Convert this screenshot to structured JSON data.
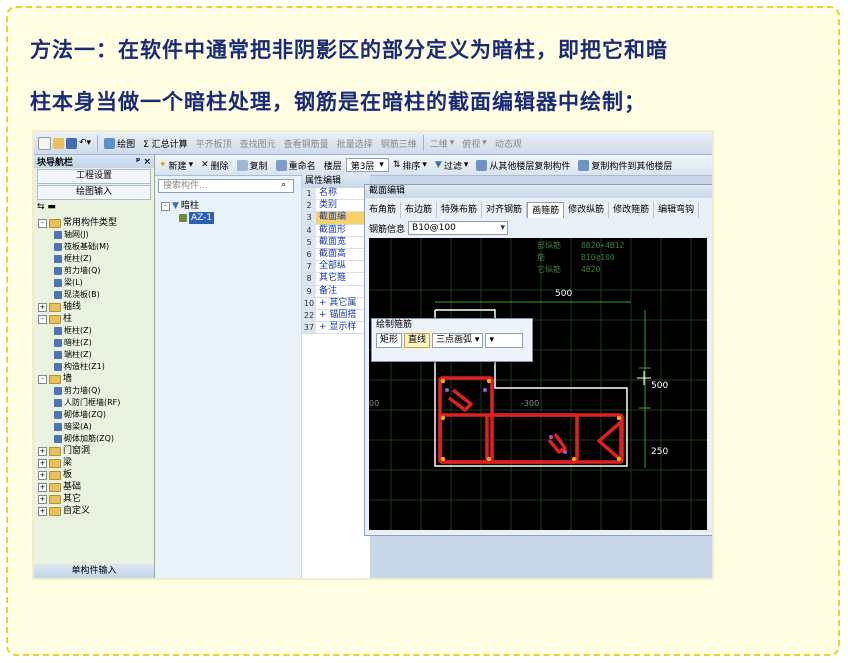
{
  "heading": {
    "line1": "方法一：在软件中通常把非阴影区的部分定义为暗柱，即把它和暗",
    "line2": "柱本身当做一个暗柱处理，钢筋是在暗柱的截面编辑器中绘制；"
  },
  "toolbar": {
    "draw": "绘图",
    "sum": "Σ 汇总计算",
    "flat_top": "平齐板顶",
    "find_element": "查找图元",
    "view_rebar": "查看钢筋量",
    "batch_select": "批量选择",
    "rebar_3d": "钢筋三维",
    "view_2d": "二维",
    "overview": "俯视",
    "dynamic": "动态观"
  },
  "nav": {
    "title": "块导航栏",
    "pin": "ᵖ ×",
    "btn_settings": "工程设置",
    "btn_draw_input": "绘图输入",
    "footer": "单构件输入",
    "tree": [
      {
        "label": "常用构件类型",
        "kind": "folder",
        "indent": 0,
        "sign": "-"
      },
      {
        "label": "轴网(J)",
        "kind": "leaf",
        "indent": 2
      },
      {
        "label": "筏板基础(M)",
        "kind": "leaf",
        "indent": 2
      },
      {
        "label": "框柱(Z)",
        "kind": "leaf",
        "indent": 2
      },
      {
        "label": "剪力墙(Q)",
        "kind": "leaf",
        "indent": 2
      },
      {
        "label": "梁(L)",
        "kind": "leaf",
        "indent": 2
      },
      {
        "label": "现浇板(B)",
        "kind": "leaf",
        "indent": 2
      },
      {
        "label": "轴线",
        "kind": "folder",
        "indent": 0,
        "sign": "+"
      },
      {
        "label": "柱",
        "kind": "folder",
        "indent": 0,
        "sign": "-"
      },
      {
        "label": "框柱(Z)",
        "kind": "leaf",
        "indent": 2
      },
      {
        "label": "暗柱(Z)",
        "kind": "leaf",
        "indent": 2
      },
      {
        "label": "端柱(Z)",
        "kind": "leaf",
        "indent": 2
      },
      {
        "label": "构造柱(Z1)",
        "kind": "leaf",
        "indent": 2
      },
      {
        "label": "墙",
        "kind": "folder",
        "indent": 0,
        "sign": "-"
      },
      {
        "label": "剪力墙(Q)",
        "kind": "leaf",
        "indent": 2
      },
      {
        "label": "人防门框墙(RF)",
        "kind": "leaf",
        "indent": 2
      },
      {
        "label": "砌体墙(ZQ)",
        "kind": "leaf",
        "indent": 2
      },
      {
        "label": "暗梁(A)",
        "kind": "leaf",
        "indent": 2
      },
      {
        "label": "砌体加筋(ZQ)",
        "kind": "leaf",
        "indent": 2
      },
      {
        "label": "门窗洞",
        "kind": "folder",
        "indent": 0,
        "sign": "+"
      },
      {
        "label": "梁",
        "kind": "folder",
        "indent": 0,
        "sign": "+"
      },
      {
        "label": "板",
        "kind": "folder",
        "indent": 0,
        "sign": "+"
      },
      {
        "label": "基础",
        "kind": "folder",
        "indent": 0,
        "sign": "+"
      },
      {
        "label": "其它",
        "kind": "folder",
        "indent": 0,
        "sign": "+"
      },
      {
        "label": "自定义",
        "kind": "folder",
        "indent": 0,
        "sign": "+"
      }
    ]
  },
  "subbar": {
    "new": "新建",
    "delete": "删除",
    "copy": "复制",
    "rename": "重命名",
    "floor_label": "楼层",
    "floor_value": "第3层",
    "sort": "排序",
    "filter": "过滤",
    "copy_from": "从其他楼层复制构件",
    "copy_to": "复制构件到其他楼层"
  },
  "component_list": {
    "search_placeholder": "搜索构件...",
    "group": "暗柱",
    "item": "AZ-1"
  },
  "properties": {
    "title": "属性编辑",
    "rows": [
      {
        "n": "1",
        "label": "名称"
      },
      {
        "n": "2",
        "label": "类别"
      },
      {
        "n": "3",
        "label": "截面编"
      },
      {
        "n": "4",
        "label": "截面形"
      },
      {
        "n": "5",
        "label": "截面宽"
      },
      {
        "n": "6",
        "label": "截面高"
      },
      {
        "n": "7",
        "label": "全部纵"
      },
      {
        "n": "8",
        "label": "其它箍"
      },
      {
        "n": "9",
        "label": "备注"
      },
      {
        "n": "10",
        "label": "+ 其它属"
      },
      {
        "n": "22",
        "label": "+ 锚固搭"
      },
      {
        "n": "37",
        "label": "+ 显示样"
      }
    ]
  },
  "editor": {
    "title": "截面编辑",
    "tabs": [
      "布角筋",
      "布边筋",
      "特殊布筋",
      "对齐钢筋",
      "画箍筋",
      "修改纵筋",
      "修改箍筋",
      "编辑弯钩"
    ],
    "active_tab": "画箍筋",
    "rebar_info_label": "钢筋信息",
    "rebar_info_value": "B10@100",
    "popup_title": "绘制箍筋",
    "popup_btn_rect": "矩形",
    "popup_btn_line": "直线",
    "popup_btn_arc": "三点画弧",
    "legend": [
      {
        "label": "部纵筋",
        "value": "8B20+4B12"
      },
      {
        "label": "筋",
        "value": "B10@100"
      },
      {
        "label": "它纵筋",
        "value": "4B20"
      }
    ],
    "dim_top": "500",
    "dim_right_1": "500",
    "dim_right_2": "250",
    "tick_left_1": "00",
    "tick_left_2": "-300"
  }
}
